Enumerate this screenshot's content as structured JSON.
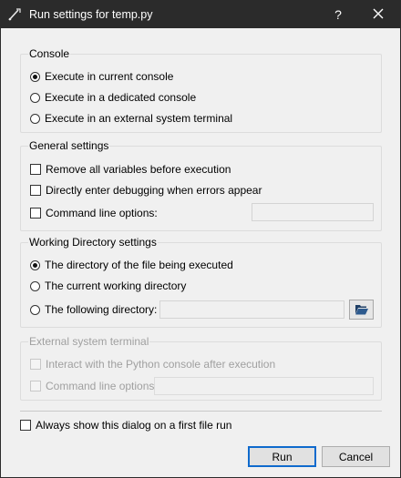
{
  "window": {
    "title": "Run settings for temp.py",
    "help_glyph": "?",
    "close_icon": "close-icon",
    "app_icon": "spyder-icon"
  },
  "console": {
    "title": "Console",
    "options": [
      {
        "label": "Execute in current console",
        "selected": true
      },
      {
        "label": "Execute in a dedicated console",
        "selected": false
      },
      {
        "label": "Execute in an external system terminal",
        "selected": false
      }
    ]
  },
  "general": {
    "title": "General settings",
    "remove_vars": {
      "label": "Remove all variables before execution",
      "checked": false
    },
    "debug": {
      "label": "Directly enter debugging when errors appear",
      "checked": false
    },
    "cmd_options": {
      "label": "Command line options:",
      "checked": false,
      "value": ""
    }
  },
  "workdir": {
    "title": "Working Directory settings",
    "options": [
      {
        "label": "The directory of the file being executed",
        "selected": true
      },
      {
        "label": "The current working directory",
        "selected": false
      },
      {
        "label": "The following directory:",
        "selected": false
      }
    ],
    "directory_value": "",
    "browse_icon": "folder-open-icon"
  },
  "external": {
    "title": "External system terminal",
    "interact": {
      "label": "Interact with the Python console after execution",
      "checked": false
    },
    "cmd_options": {
      "label": "Command line options:",
      "checked": false,
      "value": ""
    }
  },
  "always_show": {
    "label": "Always show this dialog on a first file run",
    "checked": false
  },
  "buttons": {
    "run": "Run",
    "cancel": "Cancel"
  },
  "colors": {
    "titlebar": "#2b2b2b",
    "default_button_border": "#0f6acd",
    "disabled_text": "#a0a0a0"
  }
}
